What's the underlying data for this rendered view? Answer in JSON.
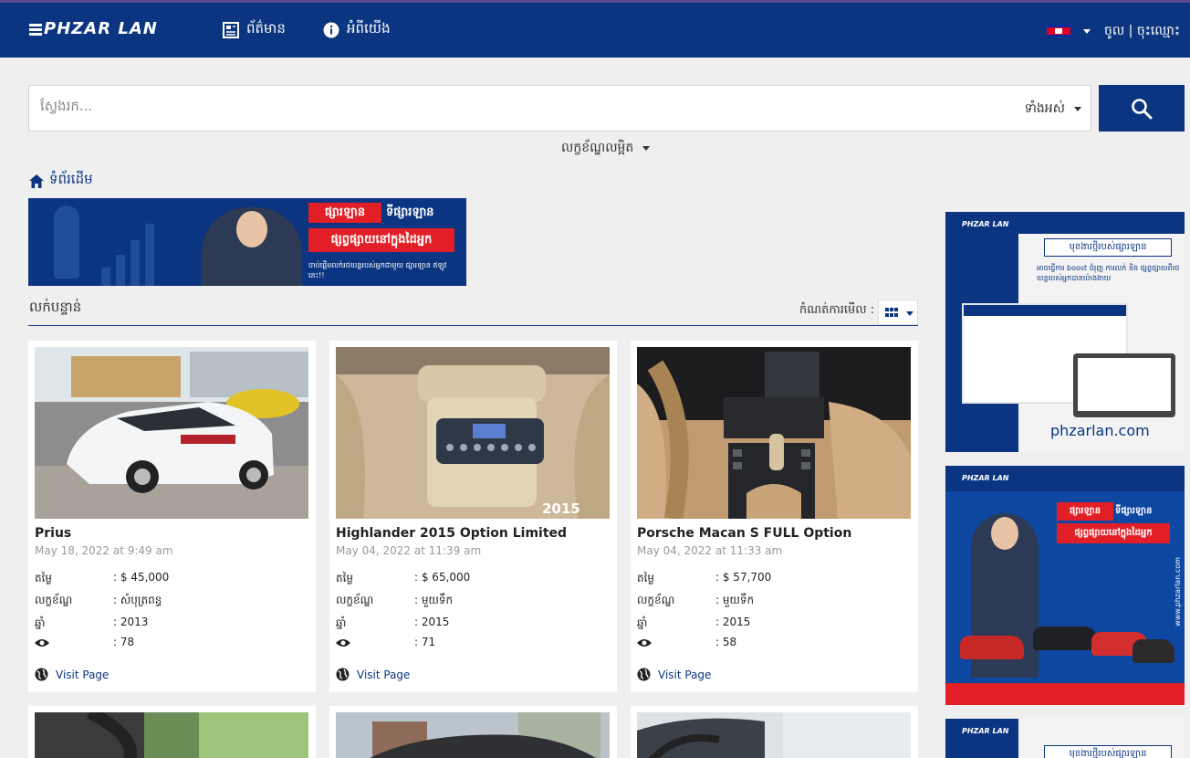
{
  "header": {
    "logo": "PHZAR LAN",
    "nav": [
      {
        "label": "ព័ត៌មាន",
        "icon": "newspaper-icon"
      },
      {
        "label": "អំពីយើង",
        "icon": "info-icon"
      }
    ],
    "language_flag": "cambodia-flag-icon",
    "auth_label": "ចូល | ចុះឈ្មោះ"
  },
  "search": {
    "placeholder": "ស្វែងរក...",
    "category_selected": "ទាំងអស់",
    "button_icon": "search-icon"
  },
  "advanced_filter_label": "លក្ខខ័ណ្ឌលម្អិត",
  "breadcrumb": {
    "home_label": "ទំព័រដើម"
  },
  "banner": {
    "brand_tag": "ផ្សារឡាន",
    "brand_tag2": "ទីផ្សារឡាន",
    "slogan": "ផ្សព្វផ្សាយនៅក្នុងដៃអ្នក",
    "small_text": "ចាប់ផ្តើមលក់រថយន្តរបស់អ្នកជាមួយ ផ្សារឡាន ឥឡូវនេះ!!"
  },
  "listing": {
    "section_title": "លក់បន្ទាន់",
    "view_label": "កំណត់ការមើល :",
    "spec_labels": {
      "price": "តម្លៃ",
      "condition": "លក្ខខ័ណ្ឌ",
      "year": "ឆ្នាំ"
    },
    "visit_label": "Visit Page",
    "cards": [
      {
        "title": "Prius",
        "date": "May 18, 2022 at 9:49 am",
        "price": ": $ 45,000",
        "condition": ": សំបុត្រពន្ធ",
        "year": ": 2013",
        "views": ": 78"
      },
      {
        "title": "Highlander 2015 Option Limited",
        "date": "May 04, 2022 at 11:39 am",
        "price": ": $ 65,000",
        "condition": ": មួយទឹក",
        "year": ": 2015",
        "views": ": 71",
        "photo_badge": "2015"
      },
      {
        "title": "Porsche Macan S FULL Option",
        "date": "May 04, 2022 at 11:33 am",
        "price": ": $ 57,700",
        "condition": ": មួយទឹក",
        "year": ": 2015",
        "views": ": 58"
      }
    ]
  },
  "side_ads": {
    "ad1_logo": "PHZAR LAN",
    "ad1_headline": "មុខងារថ្មីរបស់ផ្សារឡាន",
    "ad1_sub": "អាចធ្វើការ boost ជំរុញ ការលក់ និង ផ្សព្វផ្សាយពីរថយន្តរបស់អ្នកបានយ៉ាងងាយ",
    "ad1_url": "phzarlan.com",
    "ad2_logo": "PHZAR LAN",
    "ad2_tag": "ផ្សារឡាន",
    "ad2_tag2": "ទីផ្សារឡាន",
    "ad2_slogan": "ផ្សព្វផ្សាយនៅក្នុងដៃអ្នក",
    "ad2_url": "www.phzarlan.com",
    "ad3_logo": "PHZAR LAN",
    "ad3_headline": "មុខងារថ្មីរបស់ផ្សារឡាន"
  },
  "colors": {
    "primary": "#0b3580",
    "accent_red": "#e21f26",
    "background": "#efefef"
  }
}
